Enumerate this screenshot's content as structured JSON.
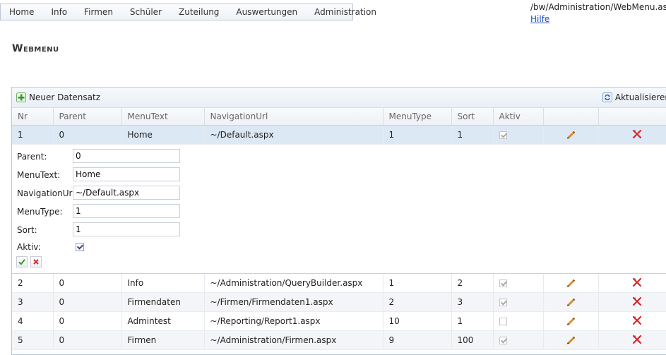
{
  "topmenu": [
    "Home",
    "Info",
    "Firmen",
    "Schüler",
    "Zuteilung",
    "Auswertungen",
    "Administration"
  ],
  "path": "/bw/Administration/WebMenu.asp",
  "help": "Hilfe",
  "title": "Webmenu",
  "toolbar": {
    "new_label": "Neuer Datensatz",
    "refresh_label": "Aktualisieren"
  },
  "columns": [
    "Nr",
    "Parent",
    "MenuText",
    "NavigationUrl",
    "MenuType",
    "Sort",
    "Aktiv"
  ],
  "rows": [
    {
      "nr": "1",
      "parent": "0",
      "text": "Home",
      "url": "~/Default.aspx",
      "type": "1",
      "sort": "1",
      "aktiv": true
    },
    {
      "nr": "2",
      "parent": "0",
      "text": "Info",
      "url": "~/Administration/QueryBuilder.aspx",
      "type": "1",
      "sort": "2",
      "aktiv": true
    },
    {
      "nr": "3",
      "parent": "0",
      "text": "Firmendaten",
      "url": "~/Firmen/Firmendaten1.aspx",
      "type": "2",
      "sort": "3",
      "aktiv": true
    },
    {
      "nr": "4",
      "parent": "0",
      "text": "Admintest",
      "url": "~/Reporting/Report1.aspx",
      "type": "10",
      "sort": "1",
      "aktiv": false
    },
    {
      "nr": "5",
      "parent": "0",
      "text": "Firmen",
      "url": "~/Administration/Firmen.aspx",
      "type": "9",
      "sort": "100",
      "aktiv": true
    }
  ],
  "edit": {
    "labels": {
      "parent": "Parent:",
      "text": "MenuText:",
      "url": "NavigationUrl:",
      "type": "MenuType:",
      "sort": "Sort:",
      "aktiv": "Aktiv:"
    },
    "values": {
      "parent": "0",
      "text": "Home",
      "url": "~/Default.aspx",
      "type": "1",
      "sort": "1",
      "aktiv": true
    }
  },
  "colors": {
    "selected_row": "#dde8f5",
    "link": "#1a4ec9",
    "delete": "#d9262c",
    "save": "#2e9a2e",
    "pencil": "#e08a1e"
  }
}
